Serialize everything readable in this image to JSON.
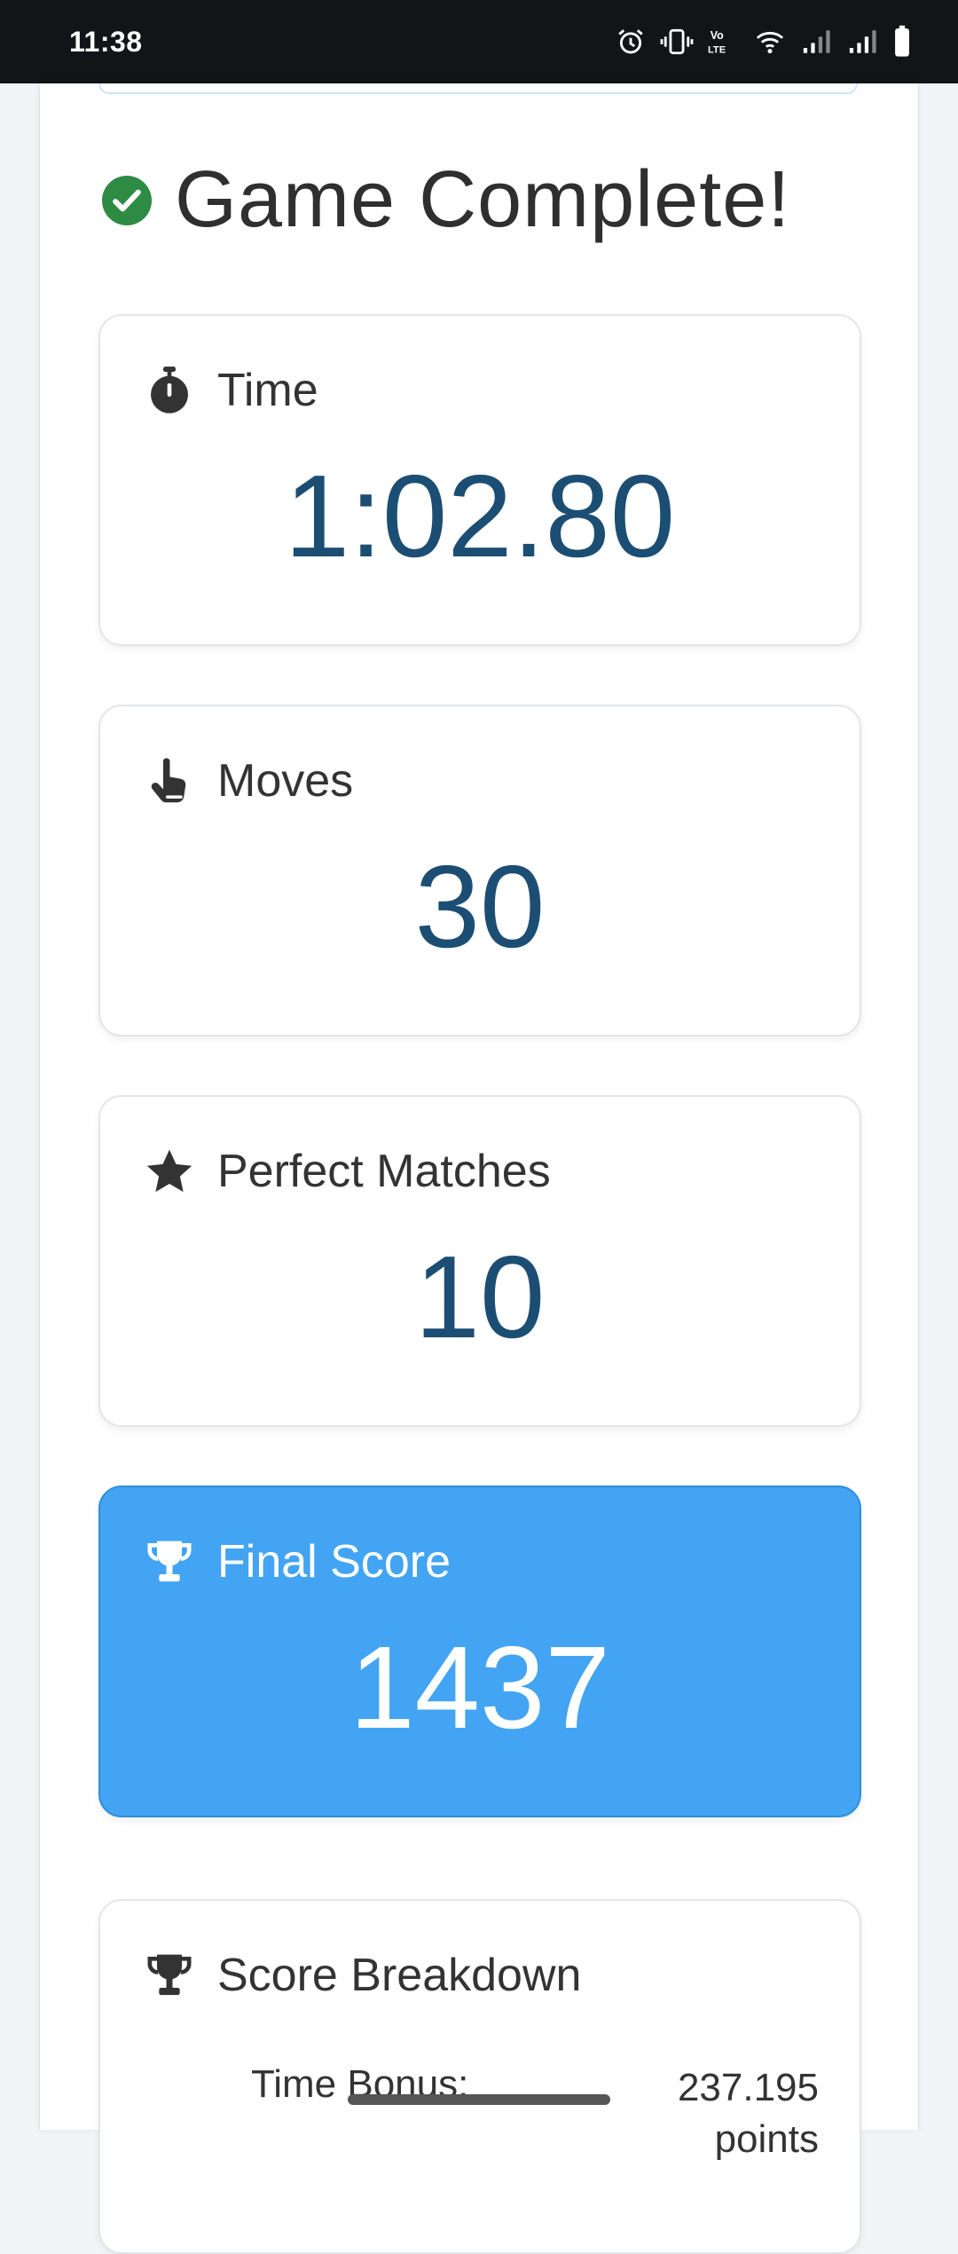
{
  "status_bar": {
    "time": "11:38",
    "icons": [
      "alarm-icon",
      "vibrate-icon",
      "volte-icon",
      "wifi-icon",
      "signal-icon",
      "signal-icon",
      "battery-icon"
    ]
  },
  "header": {
    "title": "Game Complete!",
    "icon": "check-circle-icon"
  },
  "stats": {
    "time": {
      "label": "Time",
      "value": "1:02.80",
      "icon": "stopwatch-icon"
    },
    "moves": {
      "label": "Moves",
      "value": "30",
      "icon": "pointer-hand-icon"
    },
    "perfect_matches": {
      "label": "Perfect Matches",
      "value": "10",
      "icon": "star-icon"
    },
    "final_score": {
      "label": "Final Score",
      "value": "1437",
      "icon": "trophy-icon"
    }
  },
  "breakdown": {
    "title": "Score Breakdown",
    "icon": "trophy-icon",
    "rows": [
      {
        "label": "Time Bonus:",
        "value": "237.195",
        "unit": "points"
      }
    ]
  },
  "colors": {
    "value_text": "#1c4e74",
    "score_card_bg": "#42a4f2",
    "check_green": "#2e8b44",
    "status_bar_bg": "#121418"
  }
}
